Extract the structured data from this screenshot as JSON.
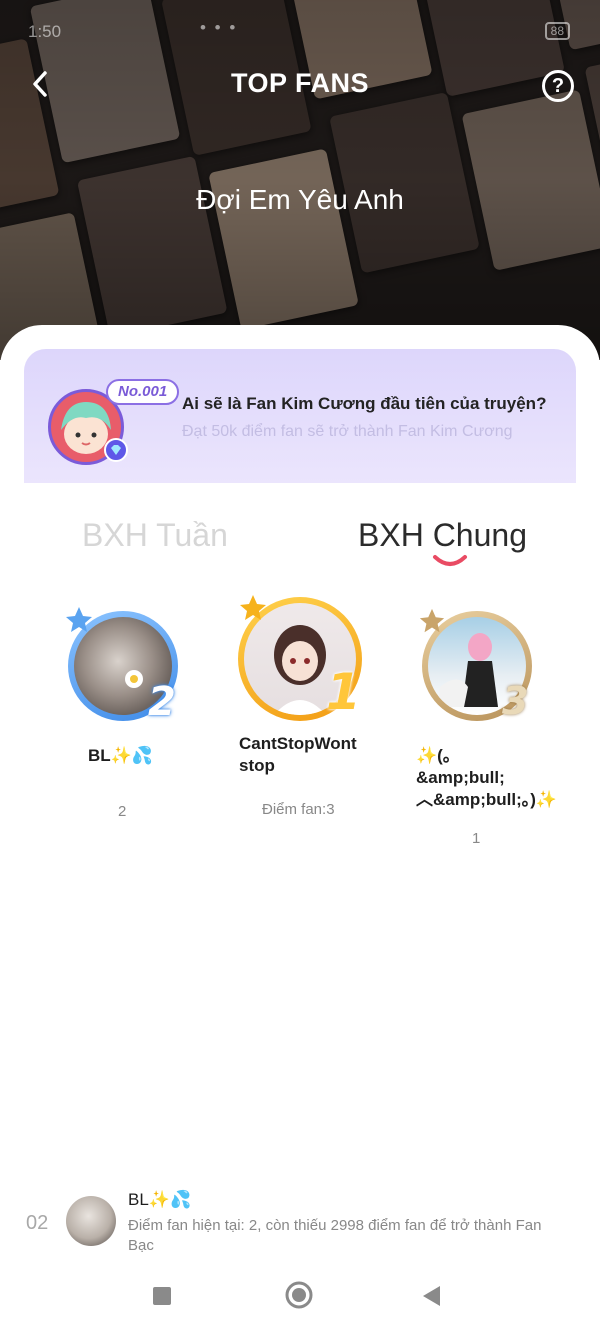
{
  "status_bar": {
    "time": "1:50",
    "battery": "88"
  },
  "header": {
    "title": "TOP FANS",
    "back_icon": "chevron-left-icon",
    "help_icon": "question-circle-icon"
  },
  "story": {
    "title": "Đợi Em Yêu Anh"
  },
  "banner": {
    "badge": "No.001",
    "title": "Ai sẽ là Fan Kim Cương đầu tiên của truyện?",
    "subtitle": "Đạt 50k điểm fan sẽ trở thành Fan Kim Cương"
  },
  "tabs": [
    {
      "label": "BXH Tuần",
      "active": false
    },
    {
      "label": "BXH Chung",
      "active": true
    }
  ],
  "podium": [
    {
      "rank": "2",
      "name": "BL✨💦",
      "score": "2",
      "ring_color": "#5aa3f0"
    },
    {
      "rank": "1",
      "name": "CantStopWont stop",
      "score": "Điểm fan:3",
      "ring_color": "#f6b21c"
    },
    {
      "rank": "3",
      "name": "✨(｡ &amp;bull;︿&amp;bull;｡)✨",
      "score": "1",
      "ring_color": "#c9a46a"
    }
  ],
  "my_rank": {
    "rank": "02",
    "name": "BL✨💦",
    "description": "Điểm fan hiện tại: 2, còn thiếu 2998 điểm fan để trở thành Fan Bạc"
  },
  "nav": {
    "recent_icon": "square-icon",
    "home_icon": "circle-icon",
    "back_icon": "triangle-back-icon"
  }
}
